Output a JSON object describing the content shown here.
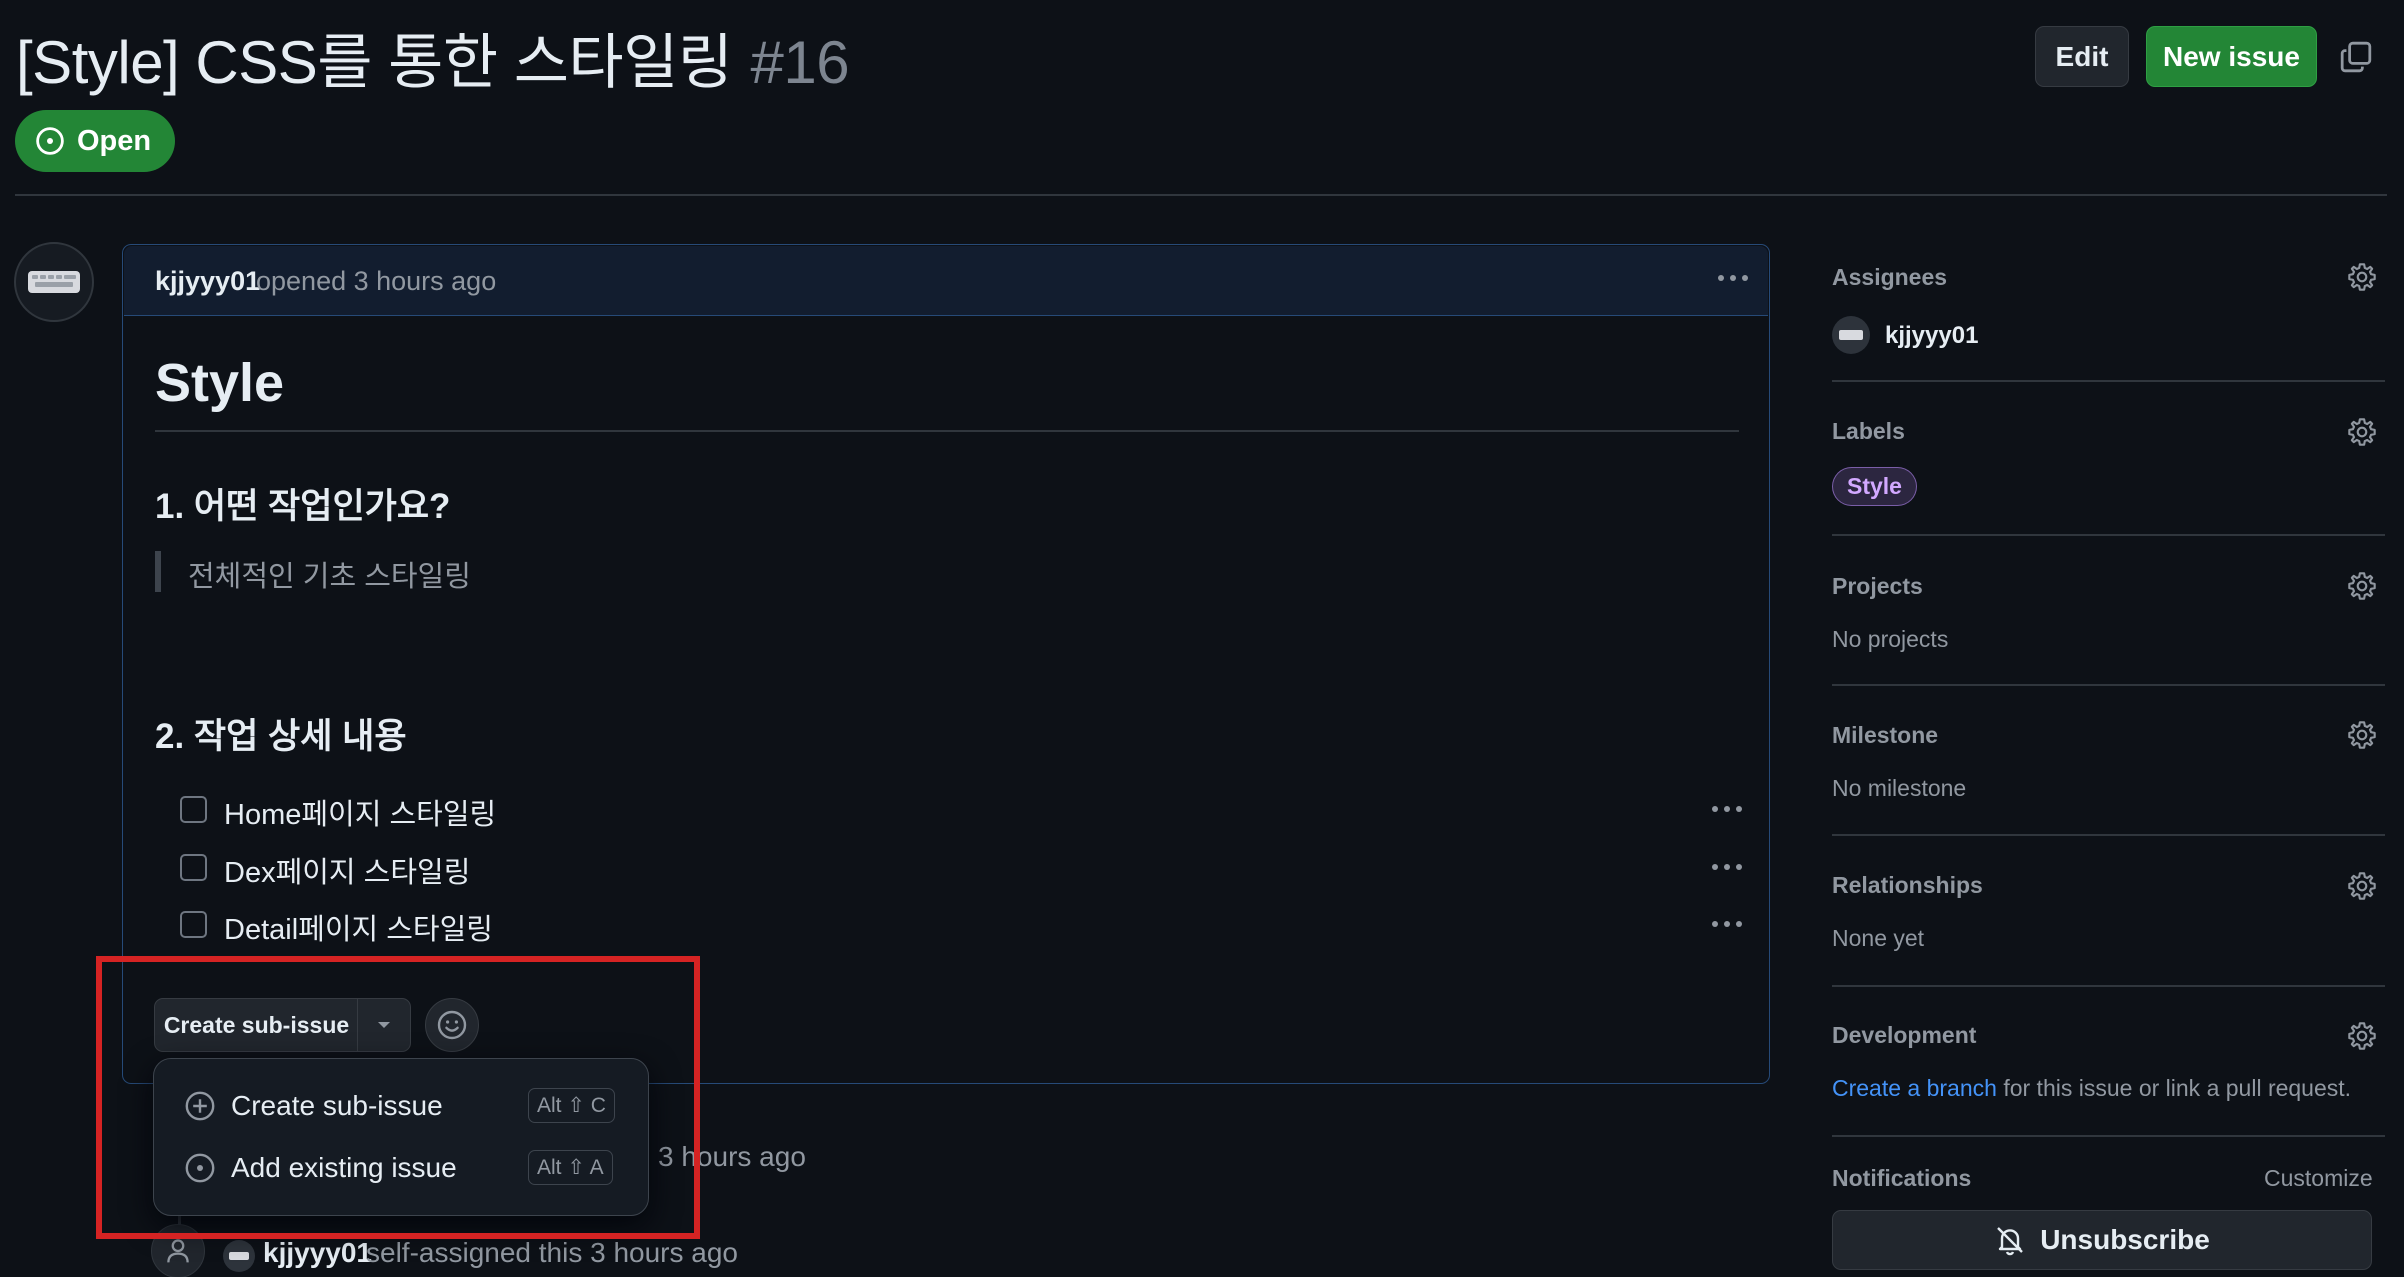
{
  "issue": {
    "title": "[Style] CSS를 통한 스타일링",
    "number": "#16",
    "state": "Open"
  },
  "header_actions": {
    "edit_label": "Edit",
    "new_issue_label": "New issue"
  },
  "comment": {
    "author": "kjjyyy01",
    "action": "opened 3 hours ago",
    "heading": "Style",
    "section1_title": "1. 어떤 작업인가요?",
    "section1_quote": "전체적인 기초 스타일링",
    "section2_title": "2. 작업 상세 내용",
    "tasks": [
      {
        "label": "Home페이지 스타일링",
        "checked": false
      },
      {
        "label": "Dex페이지 스타일링",
        "checked": false
      },
      {
        "label": "Detail페이지 스타일링",
        "checked": false
      }
    ]
  },
  "sub_issue": {
    "button_label": "Create sub-issue",
    "menu": [
      {
        "label": "Create sub-issue",
        "shortcut": "Alt ⇧ C",
        "icon": "plus-circle-icon"
      },
      {
        "label": "Add existing issue",
        "shortcut": "Alt ⇧ A",
        "icon": "issue-opened-icon"
      }
    ]
  },
  "timeline": {
    "event1_time": "3 hours ago",
    "event2_author": "kjjyyy01",
    "event2_text": "self-assigned this 3 hours ago"
  },
  "sidebar": {
    "assignees_label": "Assignees",
    "assignee_name": "kjjyyy01",
    "labels_label": "Labels",
    "label_name": "Style",
    "label_color": "#d2a8ff",
    "projects_label": "Projects",
    "projects_value": "No projects",
    "milestone_label": "Milestone",
    "milestone_value": "No milestone",
    "relationships_label": "Relationships",
    "relationships_value": "None yet",
    "development_label": "Development",
    "development_link": "Create a branch",
    "development_text": " for this issue or link a pull request.",
    "notifications_label": "Notifications",
    "customize_label": "Customize",
    "unsubscribe_label": "Unsubscribe"
  },
  "colors": {
    "background": "#0d1117",
    "open_green": "#238636",
    "link_blue": "#4493f8",
    "highlight_red": "#d52323"
  }
}
